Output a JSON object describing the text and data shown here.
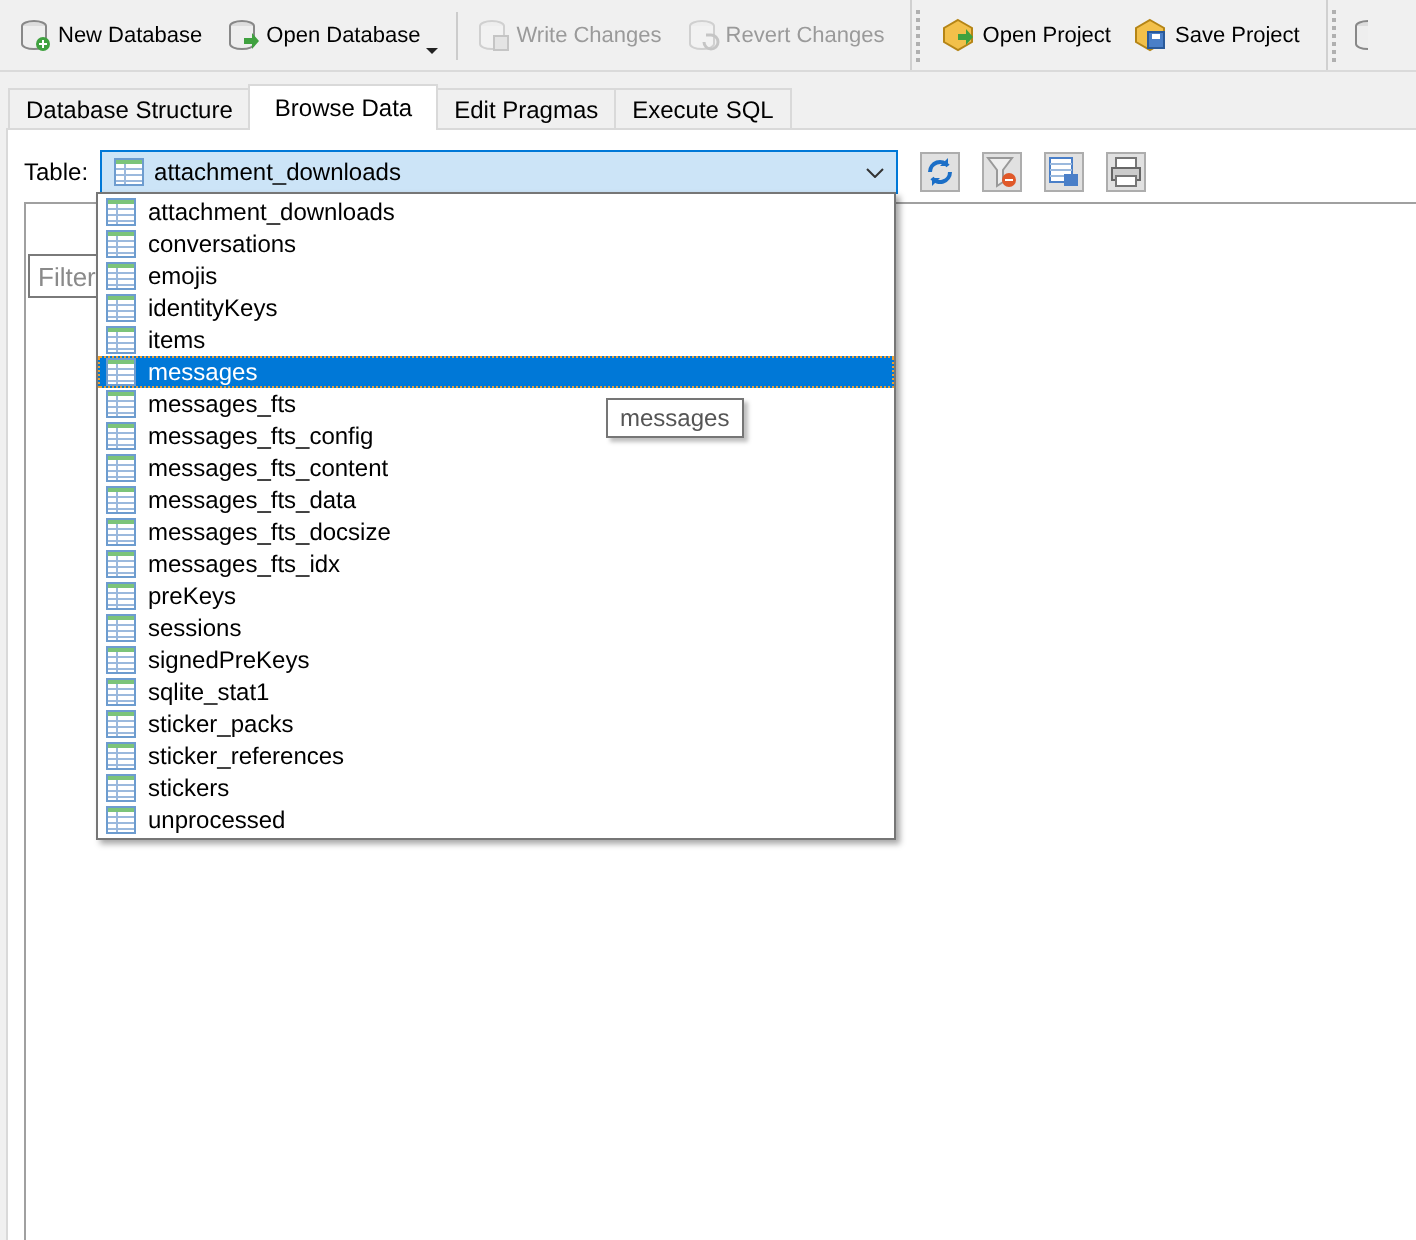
{
  "toolbar": {
    "buttons": [
      {
        "label": "New Database",
        "kind": "new-db",
        "disabled": false,
        "menu": false
      },
      {
        "label": "Open Database",
        "kind": "open-db",
        "disabled": false,
        "menu": true
      },
      {
        "label": "Write Changes",
        "kind": "write",
        "disabled": true,
        "menu": false
      },
      {
        "label": "Revert Changes",
        "kind": "revert",
        "disabled": true,
        "menu": false
      },
      {
        "label": "Open Project",
        "kind": "open-project",
        "disabled": false,
        "menu": false
      },
      {
        "label": "Save Project",
        "kind": "save-project",
        "disabled": false,
        "menu": false
      }
    ]
  },
  "tabs": [
    {
      "label": "Database Structure",
      "selected": false
    },
    {
      "label": "Browse Data",
      "selected": true
    },
    {
      "label": "Edit Pragmas",
      "selected": false
    },
    {
      "label": "Execute SQL",
      "selected": false
    }
  ],
  "browse": {
    "table_label": "Table:",
    "table_value": "attachment_downloads",
    "filter": {
      "placeholder": "Filter"
    },
    "dropdown": [
      {
        "label": "attachment_downloads",
        "selected": false
      },
      {
        "label": "conversations",
        "selected": false
      },
      {
        "label": "emojis",
        "selected": false
      },
      {
        "label": "identityKeys",
        "selected": false
      },
      {
        "label": "items",
        "selected": false
      },
      {
        "label": "messages",
        "selected": true
      },
      {
        "label": "messages_fts",
        "selected": false
      },
      {
        "label": "messages_fts_config",
        "selected": false
      },
      {
        "label": "messages_fts_content",
        "selected": false
      },
      {
        "label": "messages_fts_data",
        "selected": false
      },
      {
        "label": "messages_fts_docsize",
        "selected": false
      },
      {
        "label": "messages_fts_idx",
        "selected": false
      },
      {
        "label": "preKeys",
        "selected": false
      },
      {
        "label": "sessions",
        "selected": false
      },
      {
        "label": "signedPreKeys",
        "selected": false
      },
      {
        "label": "sqlite_stat1",
        "selected": false
      },
      {
        "label": "sticker_packs",
        "selected": false
      },
      {
        "label": "sticker_references",
        "selected": false
      },
      {
        "label": "stickers",
        "selected": false
      },
      {
        "label": "unprocessed",
        "selected": false
      }
    ],
    "tooltip": "messages"
  }
}
